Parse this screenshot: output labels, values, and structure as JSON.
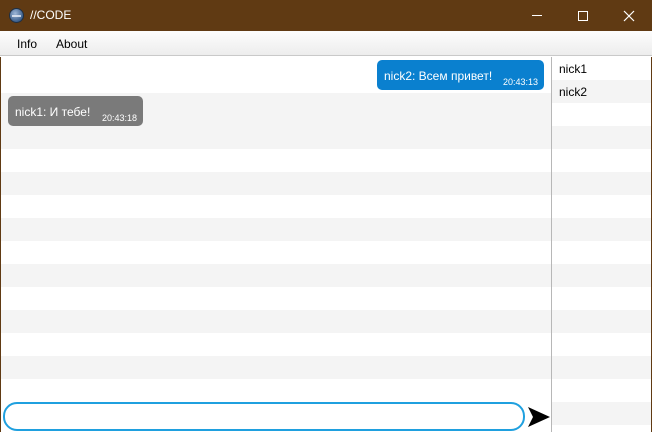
{
  "window": {
    "title": "//CODE",
    "icon": "app-globe-icon",
    "controls": [
      "minimize-icon",
      "maximize-icon",
      "close-icon"
    ]
  },
  "menu": {
    "info": "Info",
    "about": "About"
  },
  "messages": [
    {
      "text": "nick2: Всем привет!",
      "time": "20:43:13",
      "direction": "outgoing",
      "color": "#0a80cf"
    },
    {
      "text": "nick1: И тебе!",
      "time": "20:43:18",
      "direction": "incoming",
      "color": "#7a7a7a"
    }
  ],
  "users": [
    "nick1",
    "nick2"
  ],
  "input": {
    "value": "",
    "placeholder": ""
  },
  "send": {
    "icon": "send-arrow-icon"
  },
  "colors": {
    "titlebar": "#603a13",
    "input_border": "#1fa0df"
  }
}
